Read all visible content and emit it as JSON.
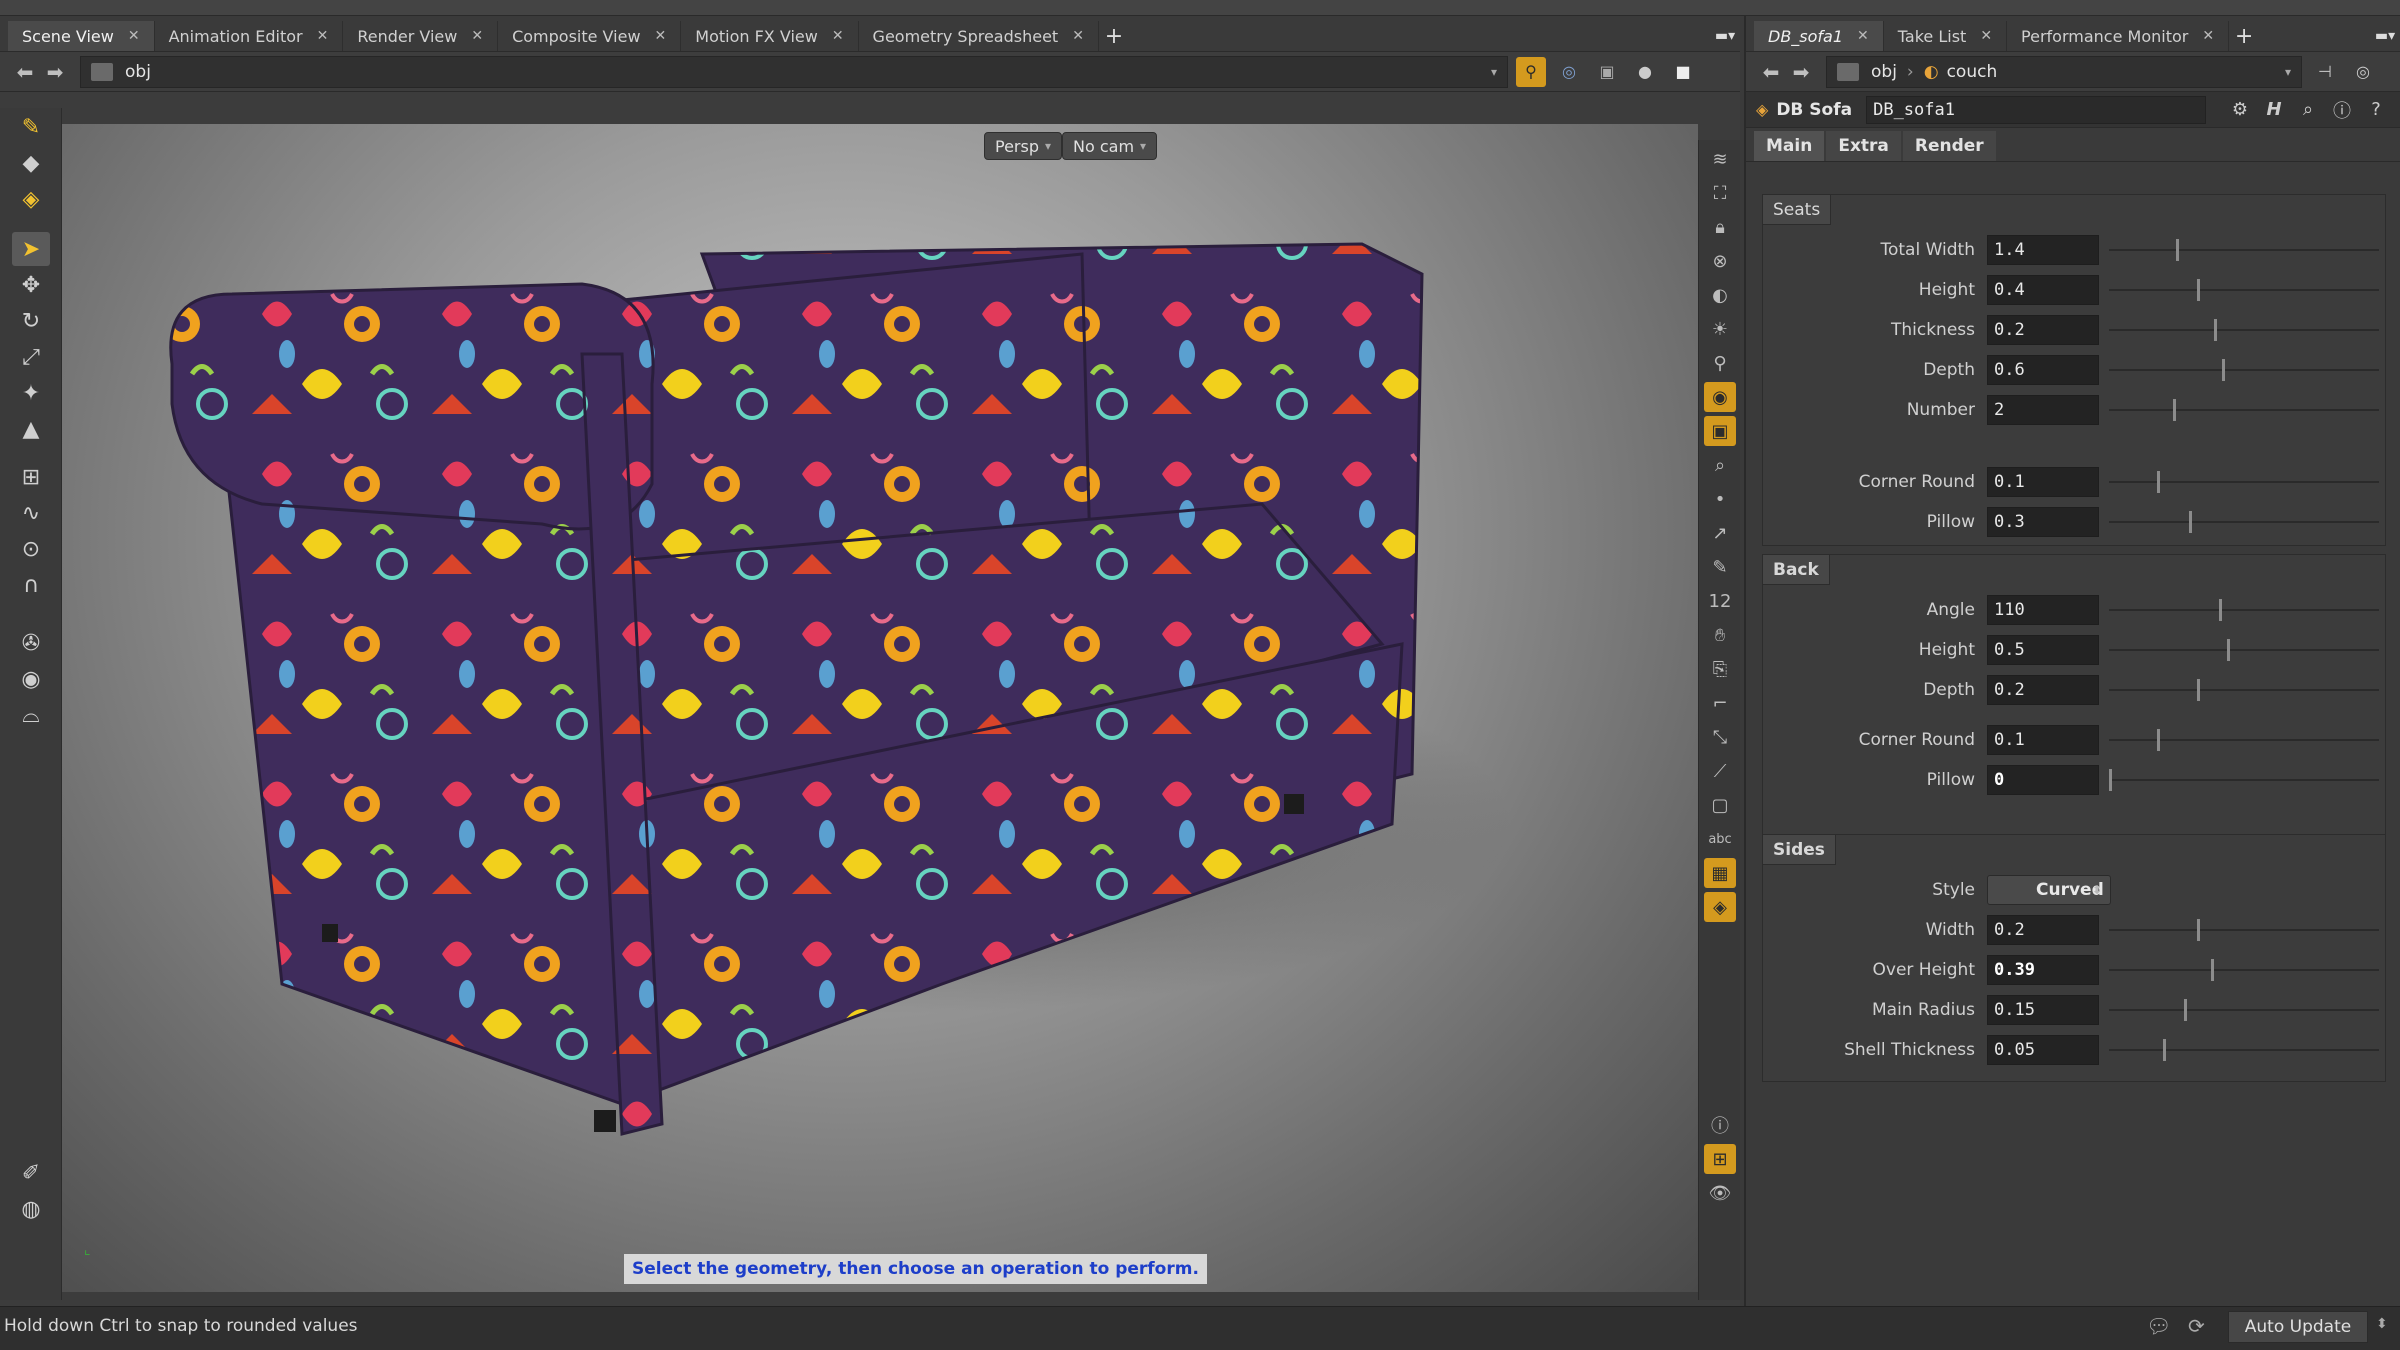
{
  "left_tabs": [
    {
      "label": "Scene View",
      "active": true
    },
    {
      "label": "Animation Editor"
    },
    {
      "label": "Render View"
    },
    {
      "label": "Composite View"
    },
    {
      "label": "Motion FX View"
    },
    {
      "label": "Geometry Spreadsheet"
    }
  ],
  "left_path": "obj",
  "viewport": {
    "camera_menu": "Persp",
    "cam_menu": "No cam",
    "hint": "Select the geometry, then choose an operation to perform."
  },
  "right_tabs": [
    {
      "label": "DB_sofa1",
      "active": true
    },
    {
      "label": "Take List"
    },
    {
      "label": "Performance Monitor"
    }
  ],
  "right_path": {
    "root": "obj",
    "node": "couch"
  },
  "node": {
    "type": "DB Sofa",
    "name": "DB_sofa1"
  },
  "param_tabs": [
    "Main",
    "Extra",
    "Render"
  ],
  "seats": {
    "title": "Seats",
    "params": [
      {
        "label": "Total Width",
        "value": "1.4",
        "pos": 0.25
      },
      {
        "label": "Height",
        "value": "0.4",
        "pos": 0.33
      },
      {
        "label": "Thickness",
        "value": "0.2",
        "pos": 0.39
      },
      {
        "label": "Depth",
        "value": "0.6",
        "pos": 0.42
      },
      {
        "label": "Number",
        "value": "2",
        "pos": 0.24
      }
    ],
    "params2": [
      {
        "label": "Corner Round",
        "value": "0.1",
        "pos": 0.18
      },
      {
        "label": "Pillow",
        "value": "0.3",
        "pos": 0.3
      }
    ]
  },
  "back": {
    "title": "Back",
    "params": [
      {
        "label": "Angle",
        "value": "110",
        "pos": 0.41
      },
      {
        "label": "Height",
        "value": "0.5",
        "pos": 0.44
      },
      {
        "label": "Depth",
        "value": "0.2",
        "pos": 0.33
      }
    ],
    "params2": [
      {
        "label": "Corner Round",
        "value": "0.1",
        "pos": 0.18
      },
      {
        "label": "Pillow",
        "value": "0",
        "pos": 0.0
      }
    ]
  },
  "sides": {
    "title": "Sides",
    "style_label": "Style",
    "style_value": "Curved",
    "params": [
      {
        "label": "Width",
        "value": "0.2",
        "pos": 0.33
      },
      {
        "label": "Over Height",
        "value": "0.39",
        "pos": 0.38
      },
      {
        "label": "Main Radius",
        "value": "0.15",
        "pos": 0.28
      },
      {
        "label": "Shell Thickness",
        "value": "0.05",
        "pos": 0.2
      }
    ]
  },
  "status": {
    "message": "Hold down Ctrl to snap to rounded values",
    "auto_update": "Auto Update"
  },
  "colors": {
    "accent": "#d49a1e",
    "hint_text": "#1d3ec9",
    "sofa_base": "#3a2a5a"
  }
}
